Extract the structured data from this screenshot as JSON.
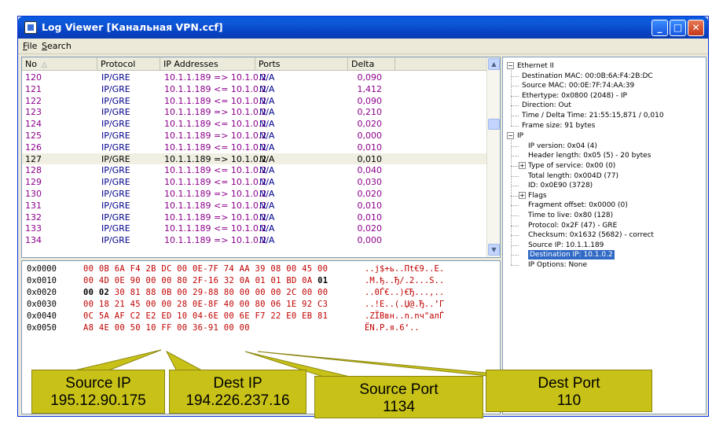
{
  "window": {
    "title": "Log Viewer [Канальная VPN.ccf]",
    "min_label": "_",
    "max_label": "□",
    "close_label": "✕"
  },
  "menu": {
    "file": {
      "accel": "F",
      "rest": "ile"
    },
    "search": {
      "accel": "S",
      "rest": "earch"
    }
  },
  "packet_list": {
    "columns": [
      "No",
      "Protocol",
      "IP Addresses",
      "Ports",
      "Delta"
    ],
    "rows": [
      {
        "no": "120",
        "protocol": "IP/GRE",
        "ip": "10.1.1.189 => 10.1.0.2",
        "ports": "N/A",
        "delta": "0,090"
      },
      {
        "no": "121",
        "protocol": "IP/GRE",
        "ip": "10.1.1.189 <= 10.1.0.2",
        "ports": "N/A",
        "delta": "1,412"
      },
      {
        "no": "122",
        "protocol": "IP/GRE",
        "ip": "10.1.1.189 <= 10.1.0.2",
        "ports": "N/A",
        "delta": "0,090"
      },
      {
        "no": "123",
        "protocol": "IP/GRE",
        "ip": "10.1.1.189 => 10.1.0.2",
        "ports": "N/A",
        "delta": "0,210"
      },
      {
        "no": "124",
        "protocol": "IP/GRE",
        "ip": "10.1.1.189 <= 10.1.0.2",
        "ports": "N/A",
        "delta": "0,020"
      },
      {
        "no": "125",
        "protocol": "IP/GRE",
        "ip": "10.1.1.189 => 10.1.0.2",
        "ports": "N/A",
        "delta": "0,000"
      },
      {
        "no": "126",
        "protocol": "IP/GRE",
        "ip": "10.1.1.189 <= 10.1.0.2",
        "ports": "N/A",
        "delta": "0,010"
      },
      {
        "no": "127",
        "protocol": "IP/GRE",
        "ip": "10.1.1.189 => 10.1.0.2",
        "ports": "N/A",
        "delta": "0,010",
        "selected": true
      },
      {
        "no": "128",
        "protocol": "IP/GRE",
        "ip": "10.1.1.189 <= 10.1.0.2",
        "ports": "N/A",
        "delta": "0,040"
      },
      {
        "no": "129",
        "protocol": "IP/GRE",
        "ip": "10.1.1.189 <= 10.1.0.2",
        "ports": "N/A",
        "delta": "0,030"
      },
      {
        "no": "130",
        "protocol": "IP/GRE",
        "ip": "10.1.1.189 => 10.1.0.2",
        "ports": "N/A",
        "delta": "0,020"
      },
      {
        "no": "131",
        "protocol": "IP/GRE",
        "ip": "10.1.1.189 <= 10.1.0.2",
        "ports": "N/A",
        "delta": "0,010"
      },
      {
        "no": "132",
        "protocol": "IP/GRE",
        "ip": "10.1.1.189 => 10.1.0.2",
        "ports": "N/A",
        "delta": "0,010"
      },
      {
        "no": "133",
        "protocol": "IP/GRE",
        "ip": "10.1.1.189 <= 10.1.0.2",
        "ports": "N/A",
        "delta": "0,020"
      },
      {
        "no": "134",
        "protocol": "IP/GRE",
        "ip": "10.1.1.189 => 10.1.0.2",
        "ports": "N/A",
        "delta": "0,000"
      }
    ]
  },
  "hex": [
    {
      "offset": "0x0000",
      "bytes": "00 0B 6A F4 2B DC 00 0E-7F 74 AA 39 08 00 45 00",
      "ascii": "..j$+ь..Пt€9..E."
    },
    {
      "offset": "0x0010",
      "bytes": "00 4D 0E 90 00 00 80 2F-16 32 0A 01 01 BD 0A 01",
      "ascii": ".M.ђ..Ђ/.2...Ѕ.."
    },
    {
      "offset": "0x0020",
      "bytes": "00 02 30 81 88 0B 00 29-88 80 00 00 00 2C 00 00",
      "ascii": "..0Ѓ€..)€Ђ...,.."
    },
    {
      "offset": "0x0030",
      "bytes": "00 18 21 45 00 00 28 0E-8F 40 00 80 06 1E 92 C3",
      "ascii": "..!E..(.Џ@.Ђ..’Г"
    },
    {
      "offset": "0x0040",
      "bytes": "0C 5A AF C2 E2 ED 10 04-6E 00 6E F7 22 E0 EB 81",
      "ascii": ".ZЇВвн..n.nч\"алЃ"
    },
    {
      "offset": "0x0050",
      "bytes": "A8 4E 00 50 10 FF 00 36-91 00 00",
      "ascii": "ЁN.P.я.6‘.."
    }
  ],
  "tree": {
    "ethernet": "Ethernet II",
    "eth_children": [
      "Destination MAC: 00:0B:6A:F4:2B:DC",
      "Source MAC: 00:0E:7F:74:AA:39",
      "Ethertype: 0x0800 (2048) - IP",
      "Direction: Out",
      "Time / Delta Time: 21:55:15,871 / 0,010",
      "Frame size: 91 bytes"
    ],
    "ip": "IP",
    "ip_children": [
      "IP version: 0x04 (4)",
      "Header length: 0x05 (5) - 20 bytes",
      "Type of service: 0x00 (0)",
      "Total length: 0x004D (77)",
      "ID: 0x0E90 (3728)",
      "Flags",
      "Fragment offset: 0x0000 (0)",
      "Time to live: 0x80 (128)",
      "Protocol: 0x2F (47) - GRE",
      "Checksum: 0x1632 (5682) - correct",
      "Source IP: 10.1.1.189",
      "Destination IP: 10.1.0.2",
      "IP Options: None"
    ]
  },
  "callouts": [
    {
      "line1": "Source IP",
      "line2": "195.12.90.175"
    },
    {
      "line1": "Dest IP",
      "line2": "194.226.237.16"
    },
    {
      "line1": "Source Port",
      "line2": "1134"
    },
    {
      "line1": "Dest Port",
      "line2": "110"
    }
  ],
  "colors": {
    "accent": "#0a5ce0",
    "callout_fill": "#c8c218",
    "hex_red": "#c00000",
    "row_purple": "#8b008b"
  }
}
